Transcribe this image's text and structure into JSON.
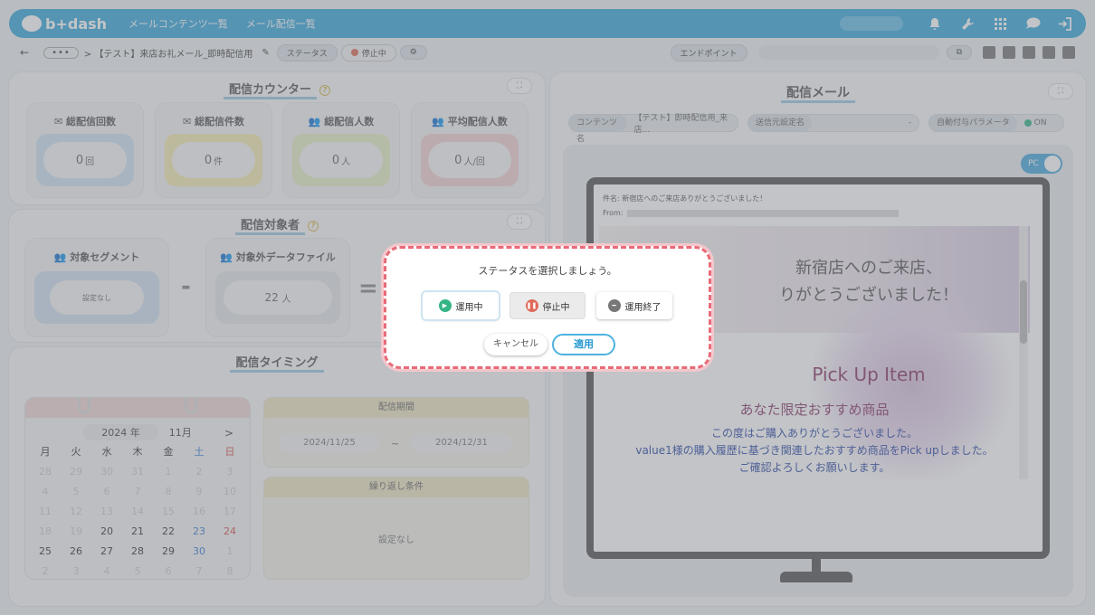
{
  "app": {
    "logo_text": "b+dash"
  },
  "nav": {
    "item1": "メールコンテンツ一覧",
    "item2": "メール配信一覧"
  },
  "subbar": {
    "more": "•••",
    "breadcrumb": "> 【テスト】来店お礼メール_即時配信用",
    "status_label": "ステータス",
    "status_value": "停止中",
    "endpoint_label": "エンドポイント"
  },
  "counter": {
    "title": "配信カウンター",
    "cards": [
      {
        "label": "総配信回数",
        "value": "0",
        "unit": "回",
        "color": "#cfe2f3"
      },
      {
        "label": "総配信件数",
        "value": "0",
        "unit": "件",
        "color": "#f6ecb3"
      },
      {
        "label": "総配信人数",
        "value": "0",
        "unit": "人",
        "color": "#e5efc5"
      },
      {
        "label": "平均配信人数",
        "value": "0",
        "unit": "人/回",
        "color": "#f5d2d2"
      }
    ]
  },
  "target": {
    "title": "配信対象者",
    "segment_label": "対象セグメント",
    "segment_value": "設定なし",
    "exclude_label": "対象外データファイル",
    "exclude_value": "22",
    "exclude_unit": "人",
    "minus": "-",
    "equals": "="
  },
  "timing": {
    "title": "配信タイミング",
    "calendar": {
      "year": "2024 年",
      "month": "11月",
      "next": ">",
      "weekdays": [
        "月",
        "火",
        "水",
        "木",
        "金",
        "土",
        "日"
      ],
      "days": [
        [
          "28",
          "29",
          "30",
          "31",
          "1",
          "2",
          "3"
        ],
        [
          "4",
          "5",
          "6",
          "7",
          "8",
          "9",
          "10"
        ],
        [
          "11",
          "12",
          "13",
          "14",
          "15",
          "16",
          "17"
        ],
        [
          "18",
          "19",
          "20",
          "21",
          "22",
          "23",
          "24"
        ],
        [
          "25",
          "26",
          "27",
          "28",
          "29",
          "30",
          "1"
        ],
        [
          "2",
          "3",
          "4",
          "5",
          "6",
          "7",
          "8"
        ]
      ]
    },
    "period_title": "配信期間",
    "period_start": "2024/11/25",
    "period_sep": "~",
    "period_end": "2024/12/31",
    "repeat_title": "繰り返し条件",
    "repeat_value": "設定なし"
  },
  "mail": {
    "title": "配信メール",
    "content_label": "コンテンツ名",
    "content_value": "【テスト】即時配信用_来店...",
    "sender_label": "送信元設定名",
    "sender_dash": "-",
    "param_label": "自動付与パラメータ",
    "param_value": "ON",
    "pc_toggle": "PC",
    "subject": "件名: 新宿店へのご来店ありがとうございました！",
    "from_label": "From:",
    "banner_line1": "新宿店へのご来店、",
    "banner_line2": "りがとうございました！",
    "pick_title": "Pick Up Item",
    "pick_sub": "あなた限定おすすめ商品",
    "text1": "この度はご購入ありがとうございました。",
    "text2": "value1様の購入履歴に基づき関連したおすすめ商品をPick upしました。",
    "text3": "ご確認よろしくお願いします。"
  },
  "modal": {
    "title": "ステータスを選択しましょう。",
    "btn_run": "運用中",
    "btn_stop": "停止中",
    "btn_end": "運用終了",
    "cancel": "キャンセル",
    "apply": "適用"
  },
  "colors": {
    "brand": "#39a8db",
    "modal_border": "#e86b78",
    "run": "#35b586",
    "stop": "#e06a5a",
    "end": "#777777"
  }
}
